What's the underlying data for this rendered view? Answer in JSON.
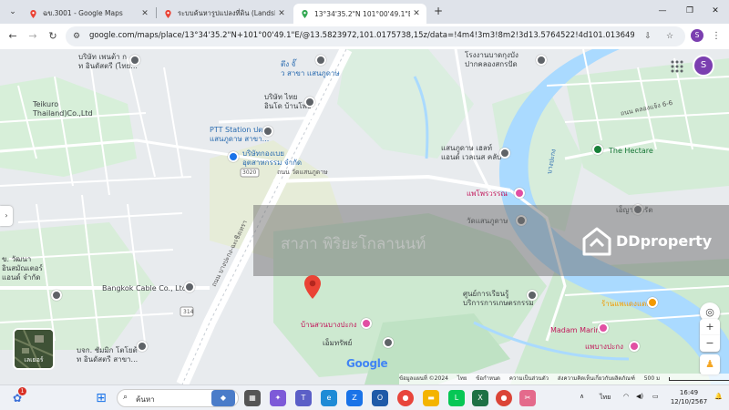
{
  "browser": {
    "tabs": [
      {
        "title": "ฉข.3001 - Google Maps",
        "active": false
      },
      {
        "title": "ระบบค้นหารูปแปลงที่ดิน (LandsMap",
        "active": false
      },
      {
        "title": "13°34'35.2\"N 101°00'49.1\"E - Goo",
        "active": true
      }
    ],
    "url": "google.com/maps/place/13°34'35.2\"N+101°00'49.1\"E/@13.5823972,101.0175738,15z/data=!4m4!3m3!8m2!3d13.5764522!4d101.0136497?entry=ttu&g_e...",
    "profile_initial": "S"
  },
  "map": {
    "avatar_initial": "S",
    "labels": {
      "top_left_company": "บริษัท เพนต้า ก\nท อินดัสตรี (ไทย...",
      "teikuro": "Teikuro\nThailand)Co.,Ltd",
      "post_office": "ตึง จั๊\nว สาขา แสนภูดาษ",
      "bancho": "บริษัท ไทย\nอินโด บ้านโพธิ์",
      "ptt": "PTT Station ปตท.\nแสนภูดาษ สาขา...",
      "ptt_sub": "บริษัทกองเบย\nอุตสาหกรรม จำกัด",
      "road_wat": "ถนน วัดแสนภูดาษ",
      "road_no": "3020",
      "school": "โรงงานบาดกุงบัง\nปากคลองสกรปัด",
      "saen_hotel": "แสนภูดาษ เฮลท์\nแอนด์ เวลเนส คลับ",
      "hectare": "The Hectare",
      "road_pakkong": "ถนน คลองแจ้ง 6-6",
      "paepriao": "แพโพรวรรณ",
      "wat": "วัดแสนภูดาษ",
      "chakkrit": "เอ็ญา จักรัต",
      "river_label": "บางปะกง",
      "bangkok_cable": "Bangkok Cable Co., Ltd",
      "left_mid": "ข. วัฒนา\nอินสมัณเตอร์\nแอนด์ จำกัด",
      "left_bottom": "บจก. ชัมมิก โตโยต้\nท อินดัสตรี สาขา...",
      "center_train": "ศูนย์การเรียนรู้\nบริการการเกษตรกรรม",
      "orange_place": "ร้านแพแดงแดง",
      "madam_marine": "Madam Marine",
      "bangpakong_river": "แพบางปะกง",
      "tiwa_park": "บ้านสวนบางปะกง",
      "enmart": "เอ็มทรัพย์",
      "road_vertical": "ถนน บางปะกง-ฉะเชิงเทรา",
      "road_code": "314"
    },
    "watermark_name": "สาภา พิริยะโกลานนท์",
    "watermark_brand": "DDproperty",
    "layer_label": "เลเยอร์",
    "google_logo": "Google",
    "footer": {
      "map_data": "ข้อมูลแผนที่ ©2024",
      "country": "ไทย",
      "terms": "ข้อกำหนด",
      "privacy": "ความเป็นส่วนตัว",
      "feedback": "ส่งความคิดเห็นเกี่ยวกับผลิตภัณฑ์",
      "scale": "500 ม"
    }
  },
  "taskbar": {
    "search_placeholder": "ค้นหา",
    "notif_count": "1",
    "lang": "ไทย",
    "time": "16:49",
    "date": "12/10/2567"
  }
}
